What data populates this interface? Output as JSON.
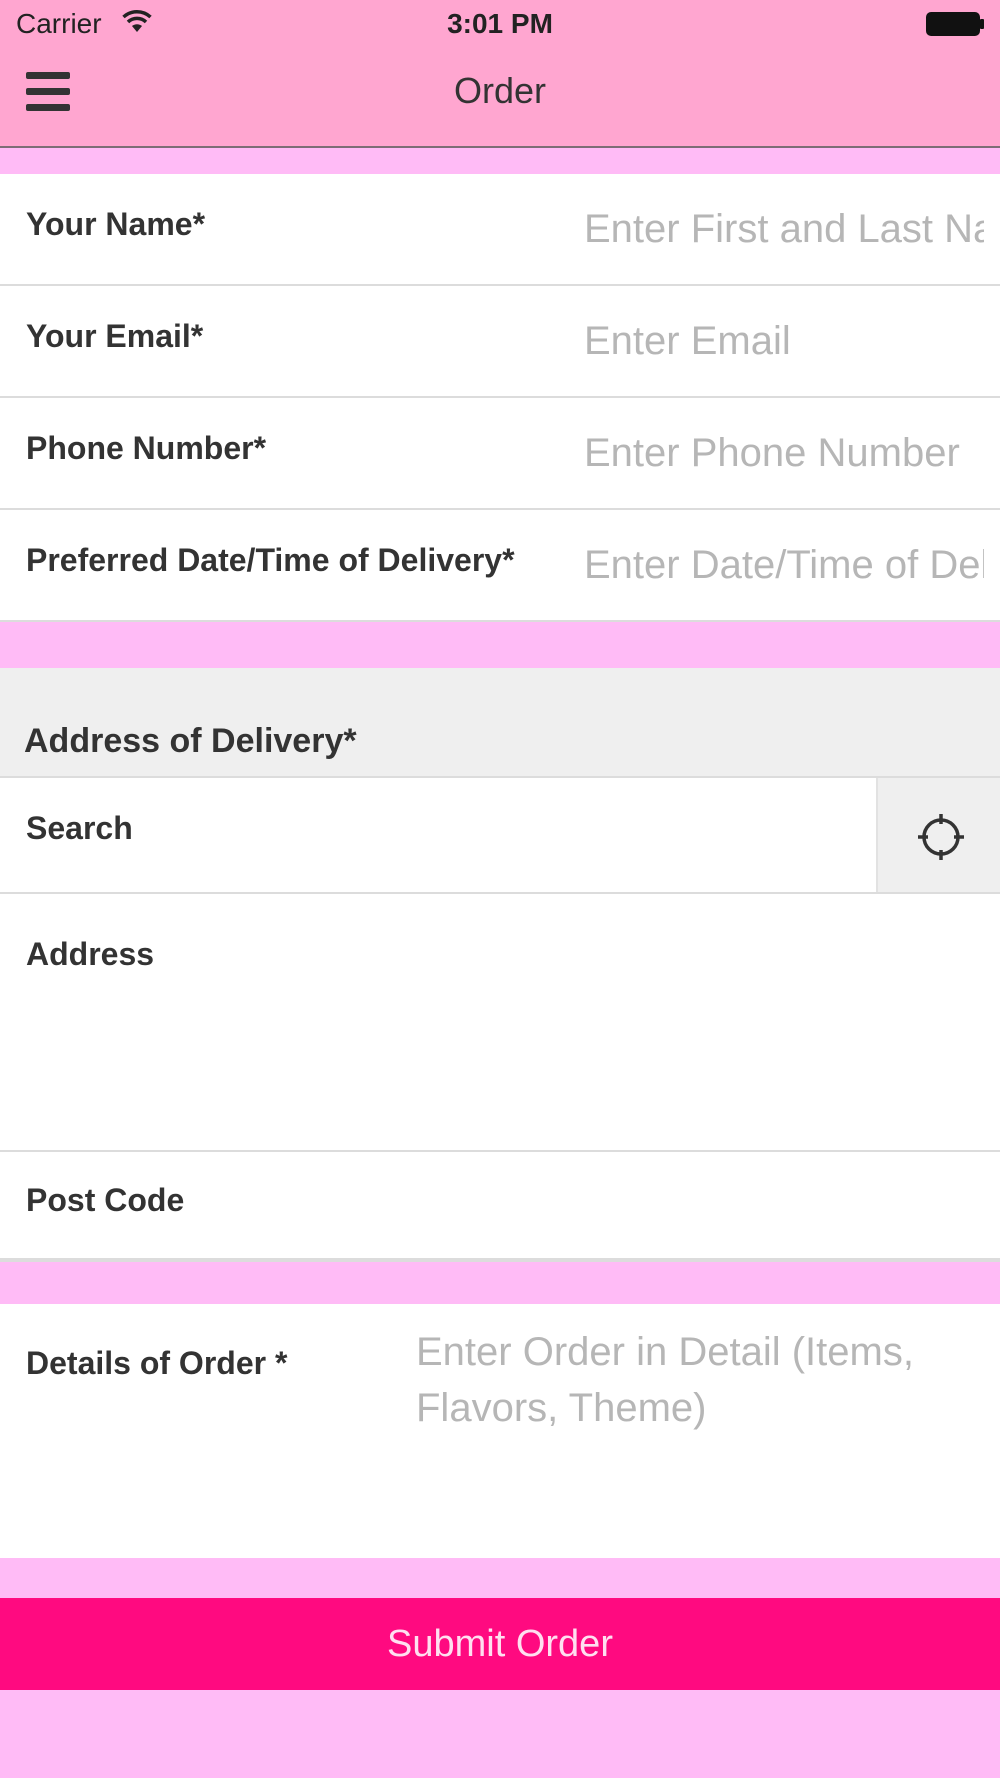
{
  "status_bar": {
    "carrier": "Carrier",
    "time": "3:01 PM"
  },
  "nav": {
    "title": "Order"
  },
  "fields": {
    "name": {
      "label": "Your Name*",
      "placeholder": "Enter First and Last Name",
      "value": ""
    },
    "email": {
      "label": "Your Email*",
      "placeholder": "Enter Email",
      "value": ""
    },
    "phone": {
      "label": "Phone Number*",
      "placeholder": "Enter Phone Number",
      "value": ""
    },
    "delivery_time": {
      "label": "Preferred Date/Time of Delivery*",
      "placeholder": "Enter Date/Time of Delivery",
      "value": ""
    }
  },
  "address_section": {
    "header": "Address of Delivery*",
    "search_label": "Search",
    "address_label": "Address",
    "post_code_label": "Post Code"
  },
  "order_details": {
    "label": "Details of Order *",
    "placeholder": "Enter Order in Detail (Items, Flavors, Theme)",
    "value": ""
  },
  "submit": {
    "label": "Submit Order"
  },
  "colors": {
    "nav_bg": "#ffa6d0",
    "page_bg": "#ffbbf6",
    "submit_bg": "#ff0a80",
    "section_bg": "#efefef"
  },
  "icons": {
    "menu": "menu-icon",
    "locate": "crosshair-icon",
    "wifi": "wifi-icon",
    "battery": "battery-icon"
  }
}
